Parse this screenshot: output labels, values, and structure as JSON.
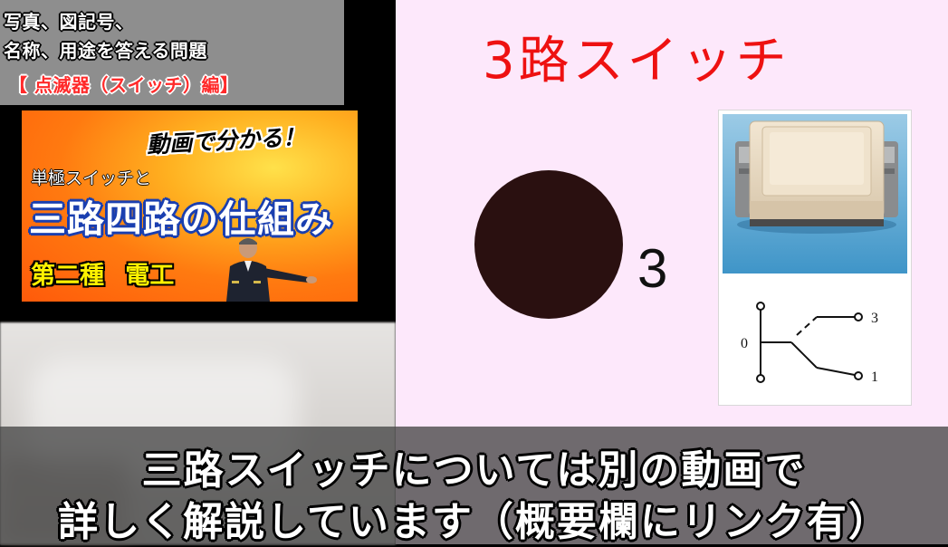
{
  "left_panel": {
    "title_lines": [
      "写真、図記号、",
      "名称、用途を答える問題",
      "【 点滅器（スイッチ）編】"
    ],
    "thumbnail": {
      "catch": "動画で分かる！",
      "subtitle": "単極スイッチと",
      "main": "三路四路の仕組み",
      "bottom": "第二種 電工"
    }
  },
  "slide": {
    "title": "3路スイッチ",
    "symbol_label": "3",
    "diagram_labels": {
      "left": "0",
      "top": "3",
      "bottom": "1"
    }
  },
  "captions": [
    "三路スイッチについては別の動画で",
    "詳しく解説しています（概要欄にリンク有）"
  ],
  "colors": {
    "slide_background": "#fde8fb",
    "title_red": "#ee1111",
    "dot": "#2a1010",
    "thumb_orange": "#ff7a10",
    "thumb_blue_outline": "#1a3fb0",
    "thumb_yellow": "#fff200"
  }
}
